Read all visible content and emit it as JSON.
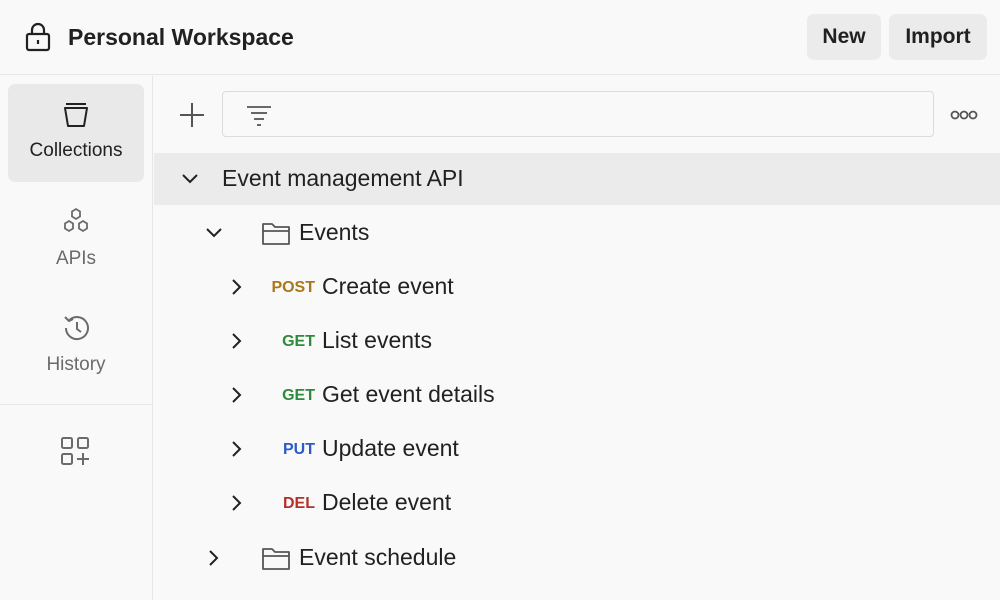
{
  "header": {
    "workspace_title": "Personal Workspace",
    "new_label": "New",
    "import_label": "Import"
  },
  "sidebar": {
    "items": [
      {
        "label": "Collections",
        "icon": "collections-icon",
        "active": true
      },
      {
        "label": "APIs",
        "icon": "apis-icon",
        "active": false
      },
      {
        "label": "History",
        "icon": "history-icon",
        "active": false
      }
    ],
    "extra_icon": "add-widget-icon"
  },
  "toolbar": {
    "filter_placeholder": "",
    "filter_value": ""
  },
  "tree": {
    "collection": {
      "name": "Event management API",
      "expanded": true
    },
    "folders": [
      {
        "name": "Events",
        "expanded": true,
        "requests": [
          {
            "method": "POST",
            "name": "Create event"
          },
          {
            "method": "GET",
            "name": "List events"
          },
          {
            "method": "GET",
            "name": "Get event details"
          },
          {
            "method": "PUT",
            "name": "Update event"
          },
          {
            "method": "DEL",
            "name": "Delete event"
          }
        ]
      },
      {
        "name": "Event schedule",
        "expanded": false,
        "requests": []
      }
    ]
  },
  "colors": {
    "POST": "#a8781a",
    "GET": "#2f8a3a",
    "PUT": "#2b5cc4",
    "DEL": "#b3302b",
    "selected_row": "#ebebeb",
    "active_nav": "#e9e9e9"
  }
}
